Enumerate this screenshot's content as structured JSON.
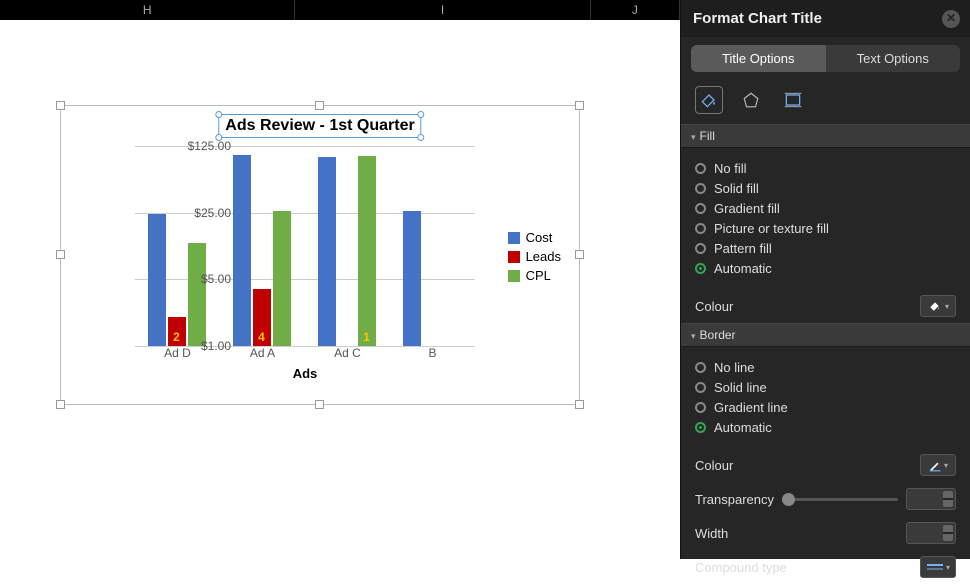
{
  "columns": [
    "H",
    "I",
    "J"
  ],
  "chart_data": {
    "type": "bar",
    "title": "Ads Review - 1st Quarter",
    "xlabel": "Ads",
    "ylabel": "",
    "y_ticks": [
      "$1.00",
      "$5.00",
      "$25.00",
      "$125.00"
    ],
    "categories": [
      "Ad D",
      "Ad A",
      "Ad C",
      "B"
    ],
    "series": [
      {
        "name": "Cost",
        "color": "#4472c4",
        "values": [
          24,
          100,
          95,
          26
        ]
      },
      {
        "name": "Leads",
        "color": "#c00000",
        "values": [
          2,
          4,
          null,
          null
        ],
        "labels": [
          "2",
          "4",
          "",
          ""
        ]
      },
      {
        "name": "CPL",
        "color": "#70ad47",
        "values": [
          12,
          26,
          98,
          null
        ],
        "labels": [
          "",
          "",
          "1",
          ""
        ]
      }
    ],
    "ylim_log": [
      1,
      125
    ]
  },
  "format_pane": {
    "title": "Format Chart Title",
    "tabs": {
      "left": "Title Options",
      "right": "Text Options",
      "active": "left"
    },
    "icons": [
      "fill-line",
      "effects",
      "size-props"
    ],
    "fill": {
      "header": "Fill",
      "options": [
        "No fill",
        "Solid fill",
        "Gradient fill",
        "Picture or texture fill",
        "Pattern fill",
        "Automatic"
      ],
      "selected": "Automatic",
      "colour_label": "Colour"
    },
    "border": {
      "header": "Border",
      "options": [
        "No line",
        "Solid line",
        "Gradient line",
        "Automatic"
      ],
      "selected": "Automatic",
      "colour_label": "Colour",
      "transparency_label": "Transparency",
      "width_label": "Width",
      "compound_label": "Compound type"
    }
  }
}
